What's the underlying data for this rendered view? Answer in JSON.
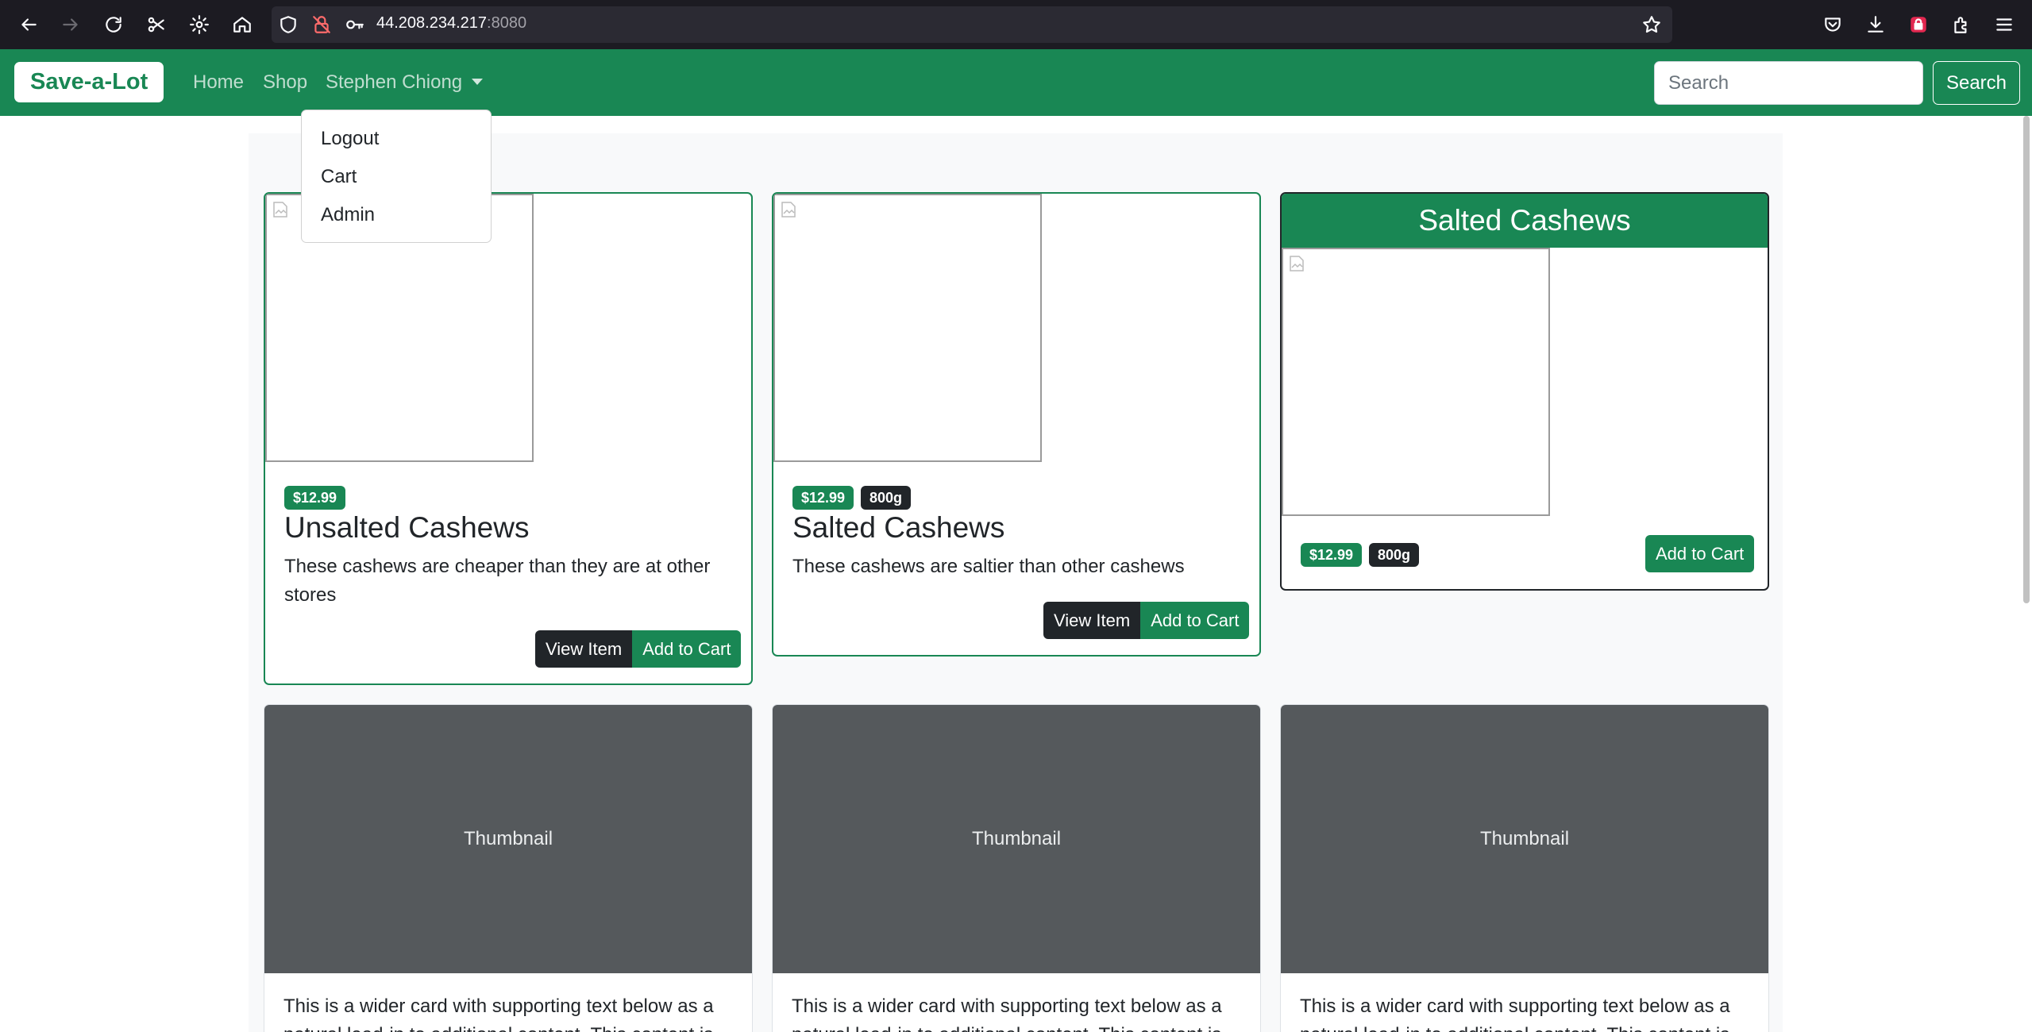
{
  "browser": {
    "url_host": "44.208.234.217",
    "url_port": ":8080"
  },
  "navbar": {
    "brand": "Save-a-Lot",
    "links": [
      "Home",
      "Shop"
    ],
    "user_menu": "Stephen Chiong",
    "search_placeholder": "Search",
    "search_button": "Search"
  },
  "dropdown": {
    "items": [
      "Logout",
      "Cart",
      "Admin"
    ]
  },
  "products": [
    {
      "price": "$12.99",
      "title": "Unsalted Cashews",
      "description": "These cashews are cheaper than they are at other stores",
      "view_label": "View Item",
      "cart_label": "Add to Cart"
    },
    {
      "price": "$12.99",
      "weight": "800g",
      "title": "Salted Cashews",
      "description": "These cashews are saltier than other cashews",
      "view_label": "View Item",
      "cart_label": "Add to Cart"
    },
    {
      "header": "Salted Cashews",
      "price": "$12.99",
      "weight": "800g",
      "cart_label": "Add to Cart"
    }
  ],
  "thumbnails": [
    {
      "label": "Thumbnail",
      "text": "This is a wider card with supporting text below as a natural lead-in to additional content. This content is"
    },
    {
      "label": "Thumbnail",
      "text": "This is a wider card with supporting text below as a natural lead-in to additional content. This content is"
    },
    {
      "label": "Thumbnail",
      "text": "This is a wider card with supporting text below as a natural lead-in to additional content. This content is"
    }
  ]
}
